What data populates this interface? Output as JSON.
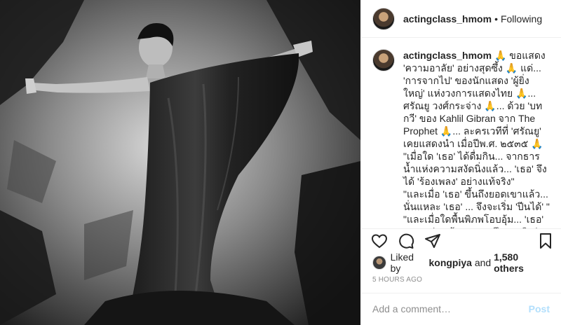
{
  "header": {
    "username": "actingclass_hmom",
    "separator": "•",
    "follow_status": "Following"
  },
  "caption": {
    "username": "actingclass_hmom",
    "text": " 🙏 ขอแสดง 'ความอาลัย' อย่างสุดซึ้ง 🙏 แด่... 'การจากไป' ของนักแสดง 'ผู้ยิ่งใหญ่' แห่งวงการแสดงไทย 🙏... ศรัณยู วงศ์กระจ่าง 🙏... ด้วย 'บทกวี' ของ Kahlil Gibran จาก The Prophet 🙏... ละครเวทีที่ 'ศรัณยู' เคยแสดงนำ เมื่อปีพ.ศ. ๒๕๓๕ 🙏\n\"เมื่อใด 'เธอ' ได้ดื่มกิน... จากธารน้ำแห่งความสงัดนิ่งแล้ว... 'เธอ' จึงได้ 'ร้องเพลง' อย่างแท้จริง\"\n\"และเมื่อ 'เธอ' ขึ้นถึงยอดเขาแล้ว... นั่นแหละ 'เธอ' ... จึงจะเริ่ม 'ปีนได้' \"\n\"และเมื่อใดพื้นพิภพโอบอุ้ม... 'เธอ' แนบแน่นแล้ว... 'เธอ' จึงจะ 'เริงร่า' ... 'ได้อย่างแท้จริง\" 🙏🙏🙏"
  },
  "icons": {
    "like": "heart-icon",
    "comment": "comment-bubble-icon",
    "share": "paper-plane-icon",
    "save": "bookmark-icon"
  },
  "likes": {
    "prefix": "Liked by",
    "user": "kongpiya",
    "mid": "and",
    "count": "1,580 others"
  },
  "timestamp": "5 HOURS AGO",
  "comment_box": {
    "placeholder": "Add a comment…",
    "post_label": "Post"
  },
  "colors": {
    "text": "#262626",
    "muted": "#8e8e8e",
    "border": "#efefef",
    "post_disabled": "#b2dffc"
  }
}
